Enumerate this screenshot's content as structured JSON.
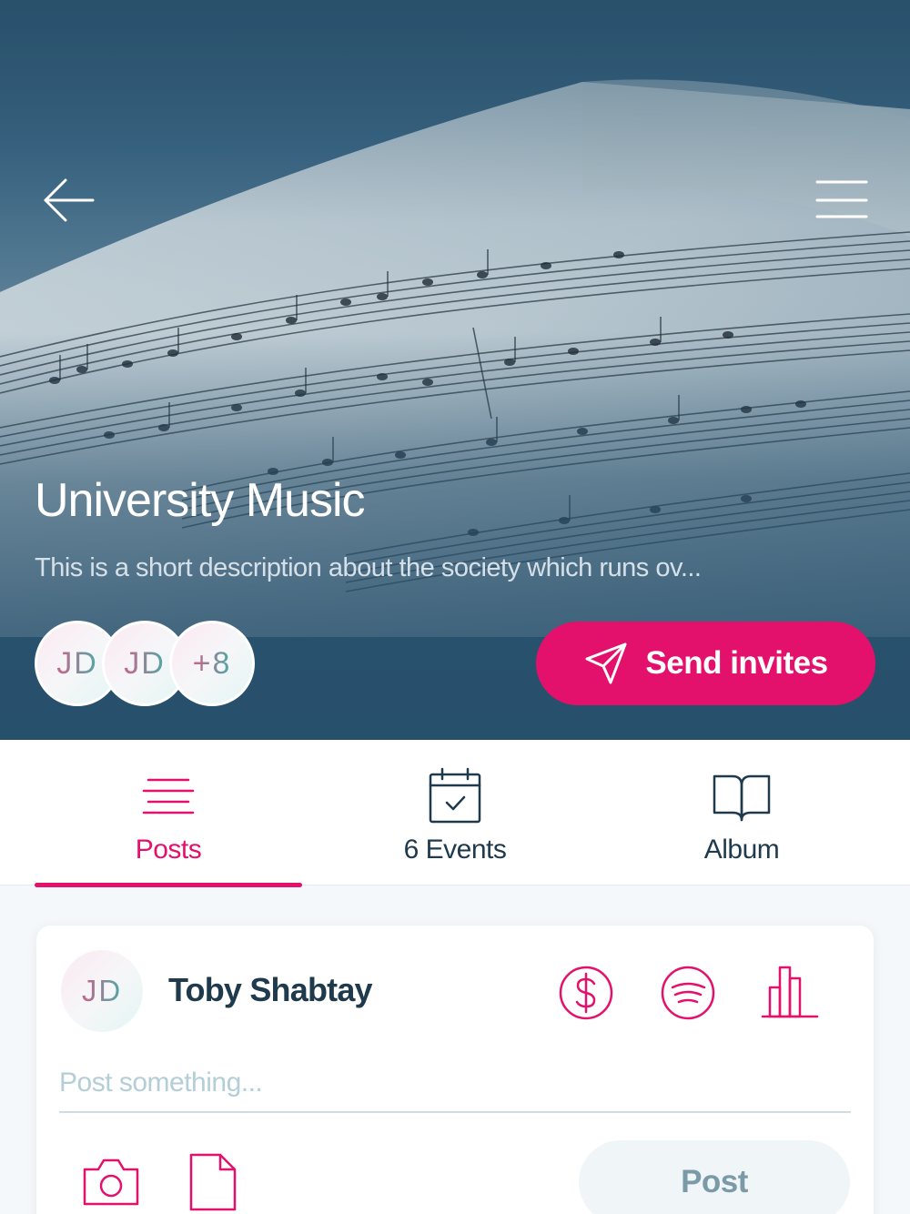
{
  "header": {
    "back_icon": "arrow-left-icon",
    "menu_icon": "hamburger-menu-icon"
  },
  "society": {
    "title": "University Music",
    "description": "This is a short description about the society which runs ov..."
  },
  "members": {
    "avatars": [
      "JD",
      "JD"
    ],
    "more_count": "+8"
  },
  "invite_button": {
    "label": "Send invites",
    "icon": "paper-plane-icon"
  },
  "tabs": [
    {
      "label": "Posts",
      "icon": "lines-icon",
      "active": true
    },
    {
      "label": "6 Events",
      "icon": "calendar-check-icon",
      "active": false
    },
    {
      "label": "Album",
      "icon": "open-book-icon",
      "active": false
    }
  ],
  "composer": {
    "avatar_initials": "JD",
    "user_name": "Toby Shabtay",
    "tools": [
      "dollar-icon",
      "spotify-icon",
      "bar-chart-icon"
    ],
    "input_value": "",
    "placeholder": "Post something...",
    "attachments": [
      "camera-icon",
      "document-icon"
    ],
    "post_label": "Post"
  },
  "colors": {
    "accent": "#e3116c",
    "dark_text": "#1e3a4c",
    "hero_overlay": "#29506c",
    "post_button_bg": "#f0f5f7"
  }
}
